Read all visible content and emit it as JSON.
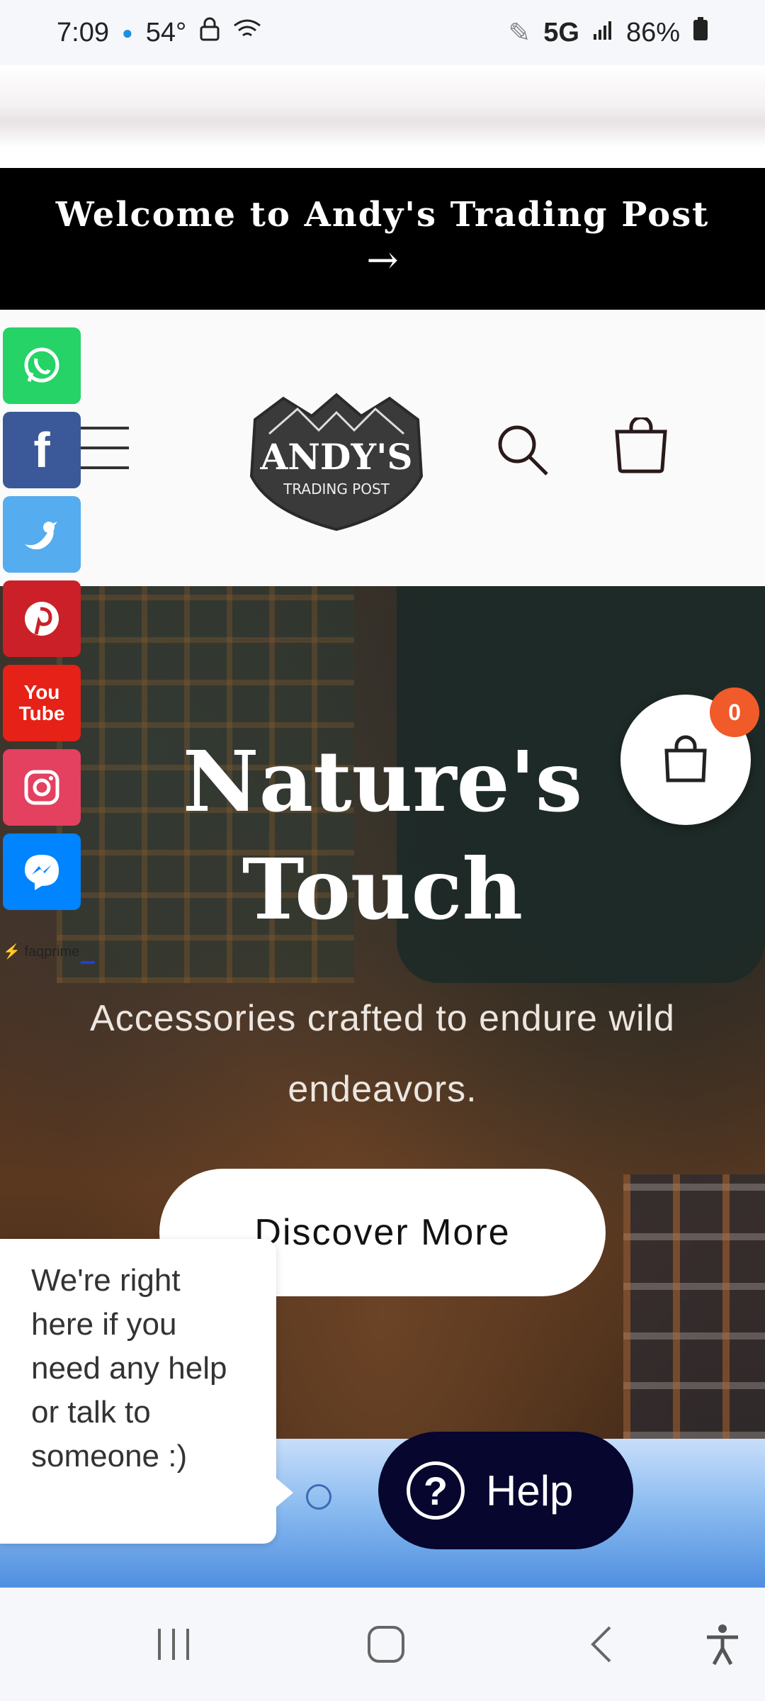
{
  "status_bar": {
    "time": "7:09",
    "temperature": "54°",
    "network": "5G",
    "battery": "86%"
  },
  "announcement": {
    "text": "Welcome to Andy's Trading Post",
    "arrow": "→"
  },
  "logo": {
    "line1": "ANDY'S",
    "line2": "TRADING POST"
  },
  "social_bar": {
    "items": [
      {
        "name": "whatsapp",
        "color": "#25d366"
      },
      {
        "name": "facebook",
        "color": "#3b5998"
      },
      {
        "name": "twitter",
        "color": "#55acee"
      },
      {
        "name": "pinterest",
        "color": "#cb2027"
      },
      {
        "name": "youtube",
        "color": "#e62117"
      },
      {
        "name": "instagram",
        "color": "#e4405f"
      },
      {
        "name": "messenger",
        "color": "#0084ff"
      }
    ],
    "branding": "faqprime"
  },
  "hero": {
    "title_line1": "Nature's",
    "title_line2": "Touch",
    "subtitle": "Accessories crafted to endure wild endeavors.",
    "cta_label": "Discover More"
  },
  "cart_fab": {
    "count": "0",
    "badge_color": "#f15a29"
  },
  "chat": {
    "tooltip": "We're right here if you need any help or talk to someone :)",
    "help_label": "Help",
    "help_color": "#06062f"
  }
}
